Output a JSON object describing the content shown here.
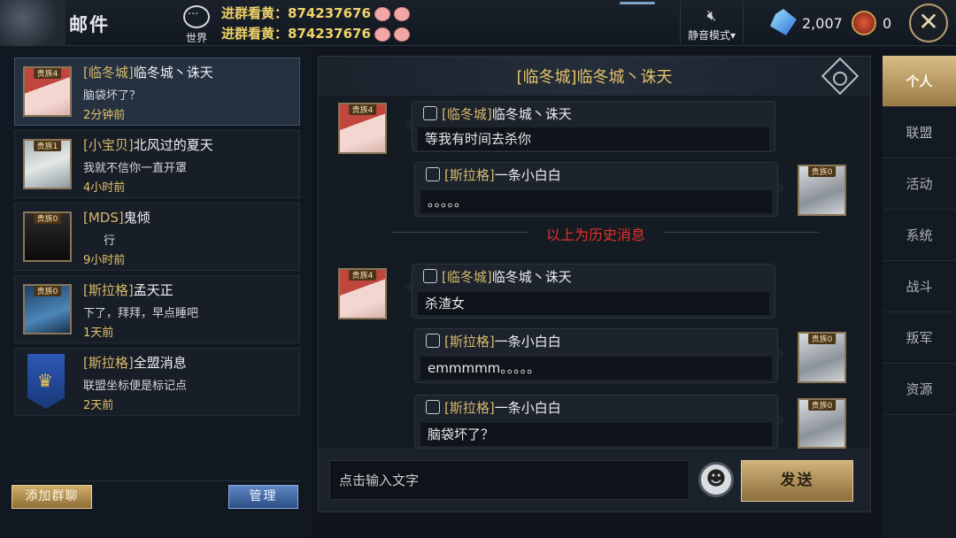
{
  "topbar": {
    "title": "邮件",
    "world_label": "世界",
    "broadcast_lines": [
      "进群看黄：874237676",
      "进群看黄：874237676"
    ],
    "mute_label": "静音模式",
    "crystal_count": "2,007",
    "coin_count": "0",
    "close_symbol": "✕"
  },
  "conversations": [
    {
      "badge": "贵族4",
      "tag": "[临冬城]",
      "name": "临冬城丶诛天",
      "message": "脑袋坏了？",
      "time": "2分钟前",
      "avatar": "av-red",
      "active": true
    },
    {
      "badge": "贵族1",
      "tag": "[小宝贝]",
      "name": "北风过的夏天",
      "message": "我就不信你一直开罩",
      "time": "4小时前",
      "avatar": "av-cat",
      "active": false
    },
    {
      "badge": "贵族0",
      "tag": "[MDS]",
      "name": "鬼倾",
      "message": "行",
      "time": "9小时前",
      "avatar": "av-dark",
      "active": false
    },
    {
      "badge": "贵族0",
      "tag": "[斯拉格]",
      "name": "孟天正",
      "message": "下了，拜拜，早点睡吧",
      "time": "1天前",
      "avatar": "av-blue",
      "active": false
    },
    {
      "badge": "",
      "tag": "[斯拉格]",
      "name": "全盟消息",
      "message": "联盟坐标便是标记点",
      "time": "2天前",
      "avatar": "banner",
      "active": false
    }
  ],
  "left_buttons": {
    "add_group": "添加群聊",
    "manage": "管理"
  },
  "chat": {
    "title": "[临冬城]临冬城丶诛天",
    "history_label": "以上为历史消息",
    "messages": [
      {
        "side": "left",
        "badge": "贵族4",
        "tag": "[临冬城]",
        "name": "临冬城丶诛天",
        "text": "等我有时间去杀你"
      },
      {
        "side": "right",
        "badge": "贵族0",
        "tag": "[斯拉格]",
        "name": "一条小白白",
        "text": "。。。。。"
      },
      {
        "side": "left",
        "badge": "贵族4",
        "tag": "[临冬城]",
        "name": "临冬城丶诛天",
        "text": "杀渣女"
      },
      {
        "side": "right",
        "badge": "贵族0",
        "tag": "[斯拉格]",
        "name": "一条小白白",
        "text": "emmmmm。。。。。"
      },
      {
        "side": "right",
        "badge": "贵族0",
        "tag": "[斯拉格]",
        "name": "一条小白白",
        "text": "脑袋坏了？"
      }
    ],
    "input_placeholder": "点击输入文字",
    "send_label": "发送"
  },
  "side_tabs": [
    {
      "label": "个人",
      "active": true
    },
    {
      "label": "联盟",
      "active": false
    },
    {
      "label": "活动",
      "active": false
    },
    {
      "label": "系统",
      "active": false
    },
    {
      "label": "战斗",
      "active": false
    },
    {
      "label": "叛军",
      "active": false
    },
    {
      "label": "资源",
      "active": false
    }
  ]
}
